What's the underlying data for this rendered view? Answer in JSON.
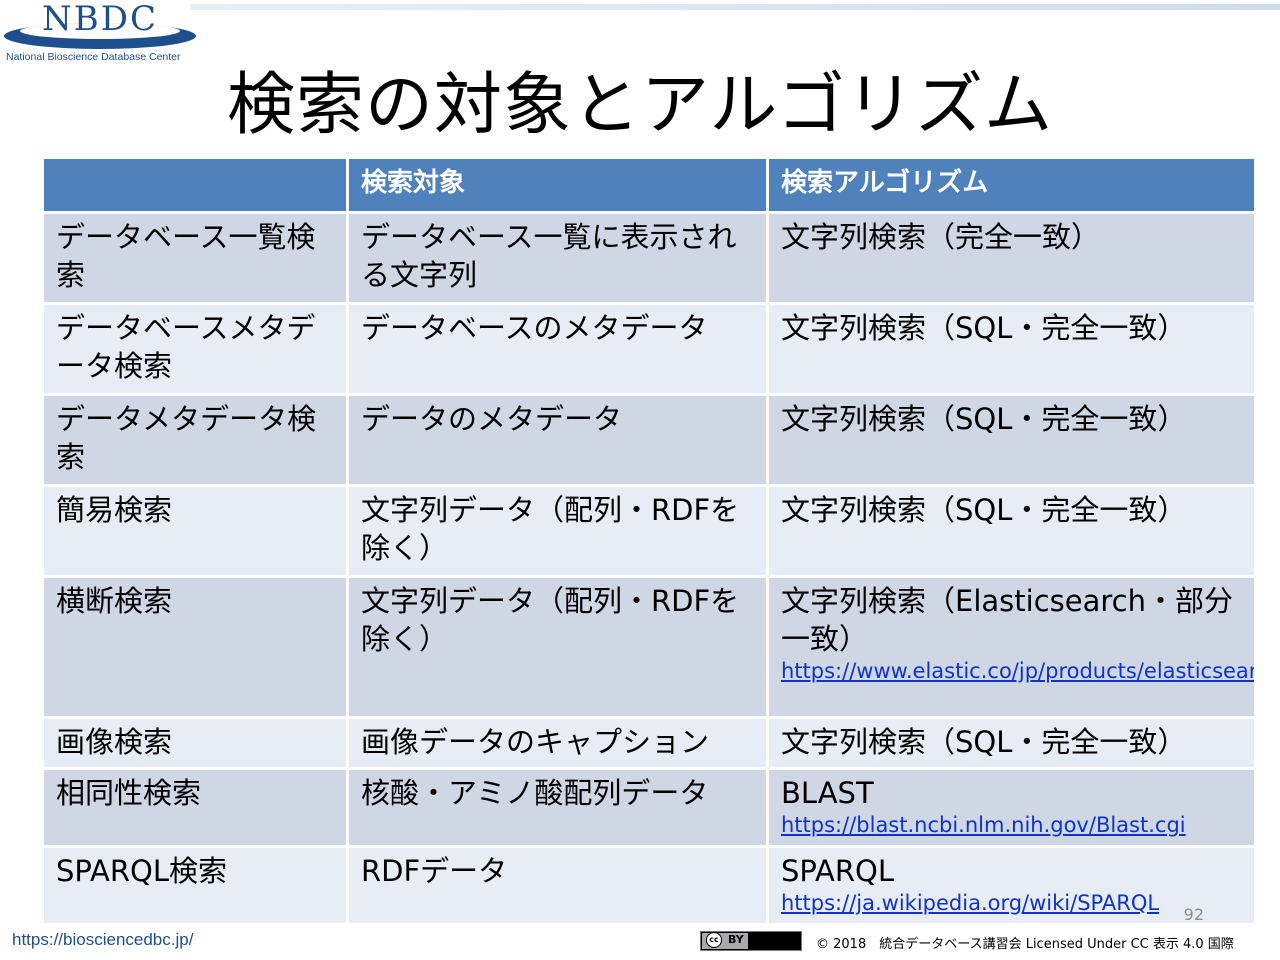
{
  "logo": {
    "text": "NBDC",
    "subtitle": "National Bioscience Database Center",
    "color": "#1f4e8c"
  },
  "title": "検索の対象とアルゴリズム",
  "table": {
    "headers": [
      "",
      "検索対象",
      "検索アルゴリズム"
    ],
    "rows": [
      {
        "name": "データベース一覧検索",
        "target": "データベース一覧に表示される文字列",
        "algorithm": "文字列検索（完全一致）",
        "url": ""
      },
      {
        "name": "データベースメタデータ検索",
        "target": "データベースのメタデータ",
        "algorithm": "文字列検索（SQL・完全一致）",
        "url": ""
      },
      {
        "name": "データメタデータ検索",
        "target": "データのメタデータ",
        "algorithm": "文字列検索（SQL・完全一致）",
        "url": ""
      },
      {
        "name": "簡易検索",
        "target": "文字列データ（配列・RDFを除く）",
        "algorithm": "文字列検索（SQL・完全一致）",
        "url": ""
      },
      {
        "name": "横断検索",
        "target": "文字列データ（配列・RDFを除く）",
        "algorithm": "文字列検索（Elasticsearch・部分一致）",
        "url": "https://www.elastic.co/jp/products/elasticsearch"
      },
      {
        "name": "画像検索",
        "target": "画像データのキャプション",
        "algorithm": "文字列検索（SQL・完全一致）",
        "url": ""
      },
      {
        "name": "相同性検索",
        "target": "核酸・アミノ酸配列データ",
        "algorithm": "BLAST",
        "url": "https://blast.ncbi.nlm.nih.gov/Blast.cgi"
      },
      {
        "name": "SPARQL検索",
        "target": "RDFデータ",
        "algorithm": "SPARQL",
        "url": "https://ja.wikipedia.org/wiki/SPARQL"
      }
    ]
  },
  "page_number": "92",
  "footer": {
    "url": "https://biosciencedbc.jp/",
    "cc_label": "BY",
    "copyright": "© 2018　統合データベース講習会 Licensed Under CC 表示 4.0 国際"
  },
  "colors": {
    "header_bg": "#4f81bd",
    "row_dark": "#cfd7e5",
    "row_light": "#e8ecf4",
    "link": "#0d33c9"
  }
}
